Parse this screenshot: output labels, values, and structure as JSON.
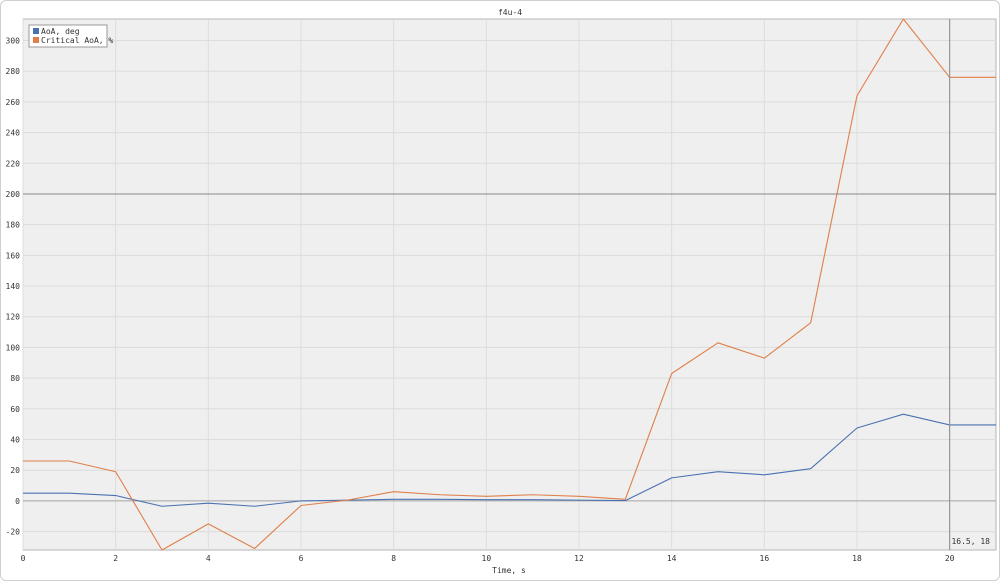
{
  "chart_data": {
    "type": "line",
    "title": "f4u-4",
    "xlabel": "Time, s",
    "ylabel": "",
    "xlim": [
      0,
      21
    ],
    "ylim": [
      -32,
      314
    ],
    "xticks": [
      0,
      2,
      4,
      6,
      8,
      10,
      12,
      14,
      16,
      18,
      20
    ],
    "yticks": [
      -20,
      0,
      20,
      40,
      60,
      80,
      100,
      120,
      140,
      160,
      180,
      200,
      220,
      240,
      260,
      280,
      300
    ],
    "grid": true,
    "legend_position": "top-left",
    "crosshair_x": 20,
    "crosshair_y": 200,
    "crosshair_label": "16.5, 18",
    "x": [
      0,
      1,
      2,
      3,
      4,
      5,
      6,
      7,
      8,
      9,
      10,
      11,
      12,
      13,
      14,
      15,
      16,
      17,
      18,
      19,
      20,
      21
    ],
    "series": [
      {
        "name": "AoA, deg",
        "color": "#4a72b0",
        "values": [
          5,
          5,
          3.5,
          -3.5,
          -1.5,
          -3.5,
          0,
          0.5,
          1,
          1,
          0.8,
          0.8,
          0.5,
          0.2,
          15,
          19,
          17,
          21,
          47.5,
          56.5,
          49.5,
          49.5
        ]
      },
      {
        "name": "Critical AoA, %",
        "color": "#e07f4a",
        "values": [
          26,
          26,
          19,
          -32,
          -15,
          -31,
          -3,
          0.5,
          6,
          4,
          3,
          4,
          3,
          1,
          83,
          103,
          93,
          116,
          264,
          314,
          276,
          276
        ]
      }
    ]
  }
}
